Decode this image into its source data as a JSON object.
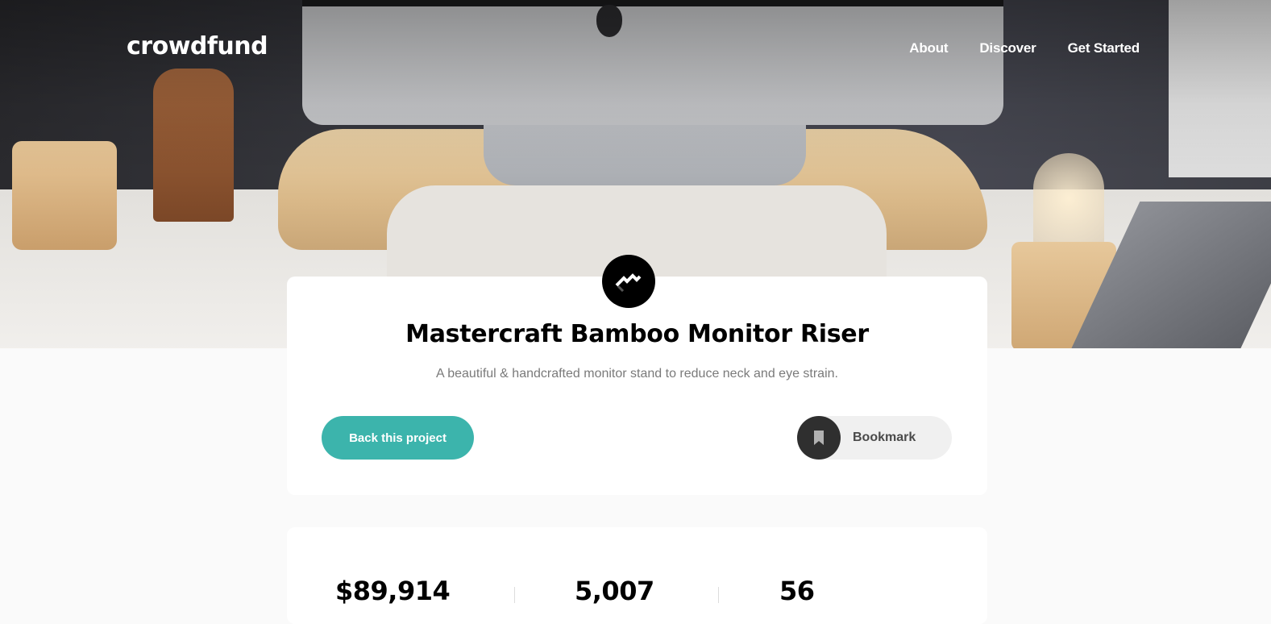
{
  "header": {
    "logo": "crowdfund",
    "nav": [
      {
        "label": "About"
      },
      {
        "label": "Discover"
      },
      {
        "label": "Get Started"
      }
    ]
  },
  "project": {
    "title": "Mastercraft Bamboo Monitor Riser",
    "description": "A beautiful & handcrafted monitor stand to reduce neck and eye strain.",
    "back_label": "Back this project",
    "bookmark_label": "Bookmark",
    "logo_icon": "mastercraft-logo-icon"
  },
  "stats": [
    {
      "value": "$89,914"
    },
    {
      "value": "5,007"
    },
    {
      "value": "56"
    }
  ],
  "colors": {
    "accent": "#3cb4ac",
    "dark": "#2f2f2f",
    "background": "#fafafa"
  }
}
